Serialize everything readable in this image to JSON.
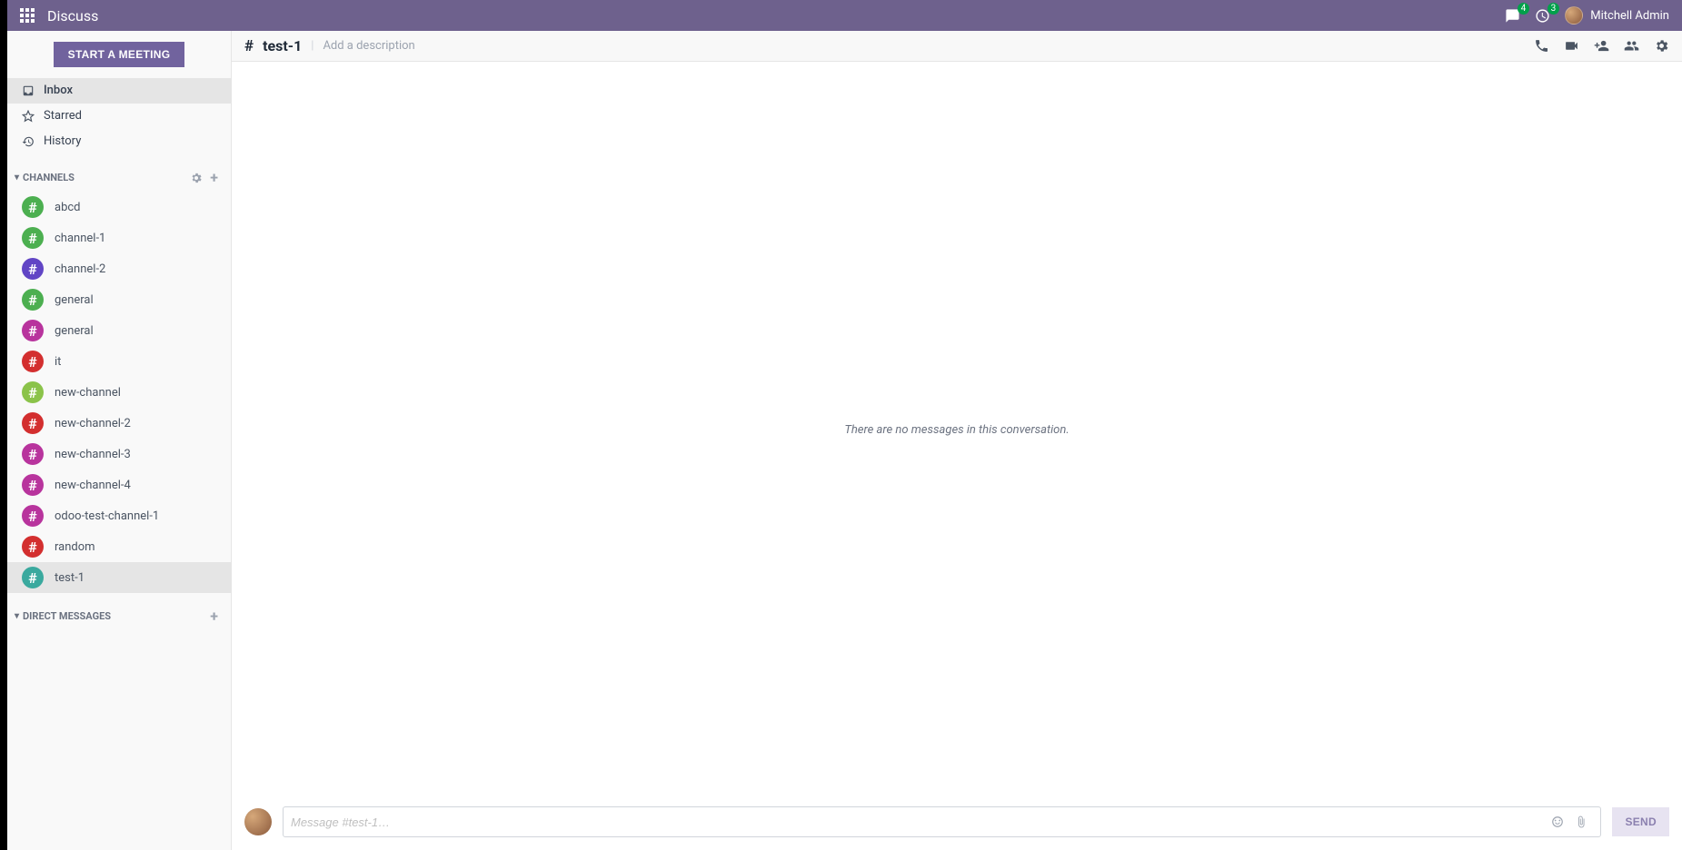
{
  "navbar": {
    "title": "Discuss",
    "messages_badge": "4",
    "activities_badge": "3",
    "user_name": "Mitchell Admin"
  },
  "sidebar": {
    "start_meeting": "START A MEETING",
    "mailboxes": [
      {
        "icon": "inbox",
        "label": "Inbox",
        "active": true
      },
      {
        "icon": "star",
        "label": "Starred",
        "active": false
      },
      {
        "icon": "history",
        "label": "History",
        "active": false
      }
    ],
    "channels_header": "CHANNELS",
    "channels": [
      {
        "name": "abcd",
        "color": "#4caf50",
        "active": false
      },
      {
        "name": "channel-1",
        "color": "#4caf50",
        "active": false
      },
      {
        "name": "channel-2",
        "color": "#6145c5",
        "active": false
      },
      {
        "name": "general",
        "color": "#4caf50",
        "active": false
      },
      {
        "name": "general",
        "color": "#b8349d",
        "active": false
      },
      {
        "name": "it",
        "color": "#d32f2f",
        "active": false
      },
      {
        "name": "new-channel",
        "color": "#8bc34a",
        "active": false
      },
      {
        "name": "new-channel-2",
        "color": "#d32f2f",
        "active": false
      },
      {
        "name": "new-channel-3",
        "color": "#b8349d",
        "active": false
      },
      {
        "name": "new-channel-4",
        "color": "#b8349d",
        "active": false
      },
      {
        "name": "odoo-test-channel-1",
        "color": "#b8349d",
        "active": false
      },
      {
        "name": "random",
        "color": "#d32f2f",
        "active": false
      },
      {
        "name": "test-1",
        "color": "#3aa99e",
        "active": true
      }
    ],
    "dm_header": "DIRECT MESSAGES"
  },
  "thread": {
    "hash": "#",
    "title": "test-1",
    "description_placeholder": "Add a description",
    "empty_text": "There are no messages in this conversation."
  },
  "composer": {
    "placeholder": "Message #test-1…",
    "send_label": "SEND"
  }
}
